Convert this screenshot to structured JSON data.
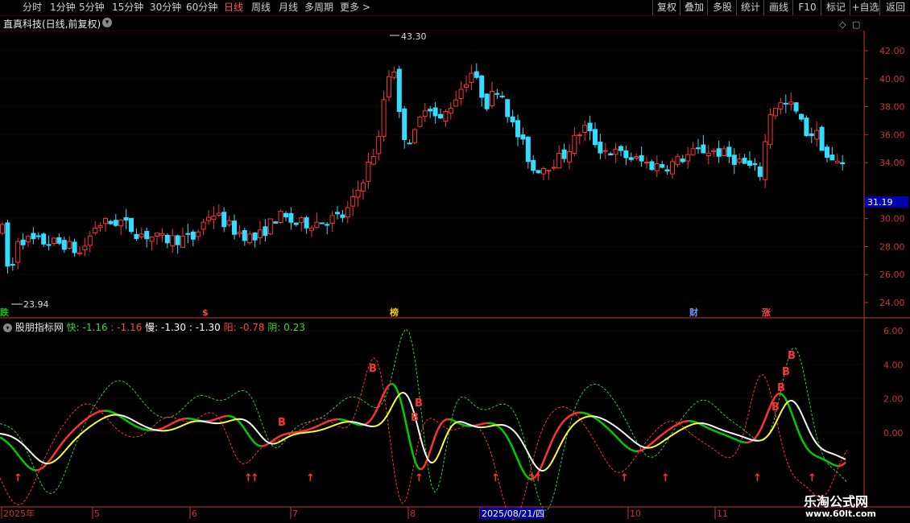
{
  "toolbar": {
    "periods": [
      {
        "label": "分时",
        "active": false
      },
      {
        "label": "1分钟",
        "active": false
      },
      {
        "label": "5分钟",
        "active": false
      },
      {
        "label": "15分钟",
        "active": false
      },
      {
        "label": "30分钟",
        "active": false
      },
      {
        "label": "60分钟",
        "active": false
      },
      {
        "label": "日线",
        "active": true
      },
      {
        "label": "周线",
        "active": false
      },
      {
        "label": "月线",
        "active": false
      },
      {
        "label": "多周期",
        "active": false
      },
      {
        "label": "更多",
        "active": false
      }
    ],
    "right_buttons": [
      "复权",
      "叠加",
      "多股",
      "统计",
      "画线",
      "F10",
      "标记",
      "+自选",
      "返回"
    ]
  },
  "stock_title": "直真科技(日线,前复权)",
  "price_axis": [
    "42.00",
    "40.00",
    "38.00",
    "36.00",
    "34.00",
    "30.00",
    "28.00",
    "26.00",
    "24.00"
  ],
  "current_price": "31.19",
  "high_label": "43.30",
  "low_label": "23.94",
  "event_markers": [
    {
      "text": "跌",
      "color": "#00cc00"
    },
    {
      "text": "$",
      "color": "#ff4444"
    },
    {
      "text": "榜",
      "color": "#ffcc00"
    },
    {
      "text": "财",
      "color": "#6699ff"
    },
    {
      "text": "涨",
      "color": "#ff4444"
    }
  ],
  "indicator": {
    "name": "股朋指标网",
    "fast_label": "快: -1.16",
    "fast_colon": ": -1.16",
    "slow_label": "慢: -1.30",
    "slow_colon": ": -1.30",
    "yang_label": "阳: -0.78",
    "yin_label": "阴: 0.23"
  },
  "indicator_axis": [
    "6.00",
    "4.00",
    "2.00",
    "0.00"
  ],
  "buy_mark": "B",
  "date_axis": [
    "2025年",
    "5",
    "6",
    "7",
    "8",
    "2025/08/21/四",
    "10",
    "11"
  ],
  "watermark": {
    "line1": "乐淘公式网",
    "line2": "www.60lt.com"
  },
  "colors": {
    "up": "#ff3333",
    "down": "#33ddff",
    "axis": "#cc3333",
    "grid": "#5a0000",
    "fast": "#00cc00",
    "slow": "#ffffff",
    "yang": "#ff3333",
    "yin": "#33cc33",
    "buy": "#ff3333",
    "cursor_date_bg": "#0000a0"
  },
  "chart_data": {
    "type": "candlestick",
    "title": "直真科技(日线,前复权)",
    "price_range": [
      23.0,
      44.0
    ],
    "high": 43.3,
    "low": 23.94,
    "last": 31.19,
    "months_shown": [
      "2025年",
      "5",
      "6",
      "7",
      "8",
      "10",
      "11"
    ]
  }
}
